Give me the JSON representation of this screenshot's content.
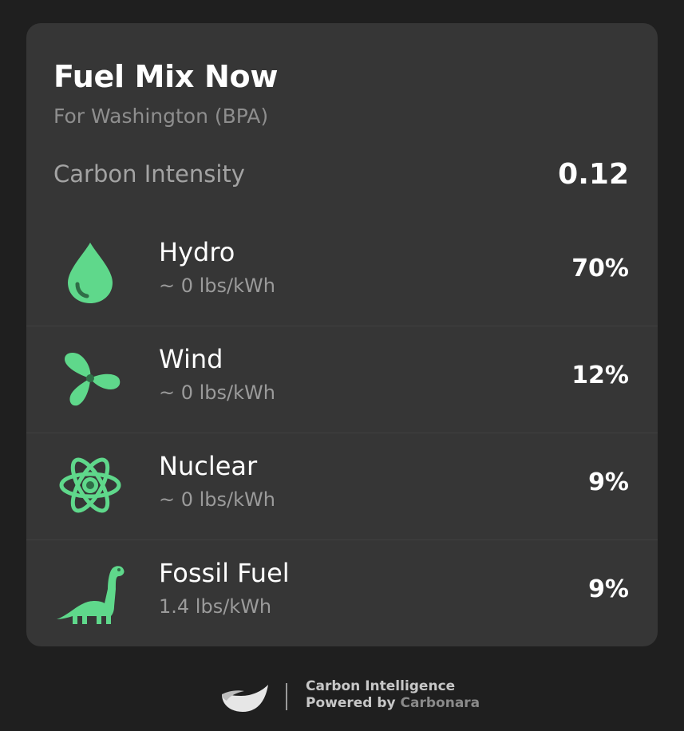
{
  "card": {
    "title": "Fuel Mix Now",
    "subtitle": "For Washington (BPA)",
    "carbon_intensity_label": "Carbon Intensity",
    "carbon_intensity_value": "0.12"
  },
  "fuels": [
    {
      "name": "Hydro",
      "rate": "~ 0 lbs/kWh",
      "percent": "70%",
      "icon": "water-drop-icon"
    },
    {
      "name": "Wind",
      "rate": "~ 0 lbs/kWh",
      "percent": "12%",
      "icon": "wind-turbine-icon"
    },
    {
      "name": "Nuclear",
      "rate": "~ 0 lbs/kWh",
      "percent": "9%",
      "icon": "atom-icon"
    },
    {
      "name": "Fossil Fuel",
      "rate": "1.4 lbs/kWh",
      "percent": "9%",
      "icon": "dinosaur-icon"
    }
  ],
  "footer": {
    "line1": "Carbon Intelligence",
    "line2_prefix": "Powered by ",
    "line2_brand": "Carbonara"
  },
  "colors": {
    "background": "#1f1f1f",
    "card": "#363636",
    "icon_green": "#5fd88b",
    "text_primary": "#ffffff",
    "text_secondary": "#9b9b9b"
  }
}
